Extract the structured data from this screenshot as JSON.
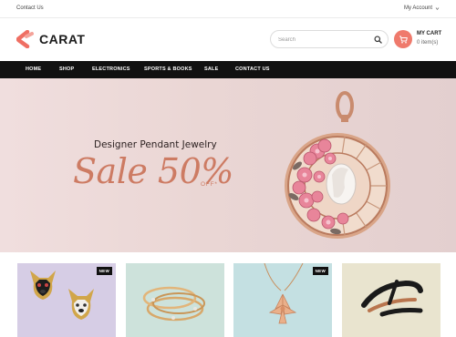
{
  "topbar": {
    "contact_label": "Contact Us",
    "account_label": "My Account"
  },
  "header": {
    "logo_text": "CARAT",
    "search": {
      "placeholder": "Search"
    },
    "cart": {
      "title": "MY CART",
      "items": "0 item(s)"
    }
  },
  "nav": {
    "items": [
      "HOME",
      "SHOP",
      "ELECTRONICS",
      "SPORTS & BOOKS",
      "SALE",
      "CONTACT US"
    ]
  },
  "hero": {
    "subtitle": "Designer Pendant Jewelry",
    "sale_text": "Sale 50%",
    "off_text": "OFF*"
  },
  "products": [
    {
      "badge": "NEW",
      "image": "bulldog-earrings"
    },
    {
      "badge": "",
      "image": "gold-bangles"
    },
    {
      "badge": "NEW",
      "image": "lily-pendant-necklace"
    },
    {
      "badge": "",
      "image": "black-gold-ring"
    }
  ],
  "colors": {
    "accent": "#ef7a6c",
    "nav_bg": "#111111",
    "hero_text": "#cd7b63"
  }
}
